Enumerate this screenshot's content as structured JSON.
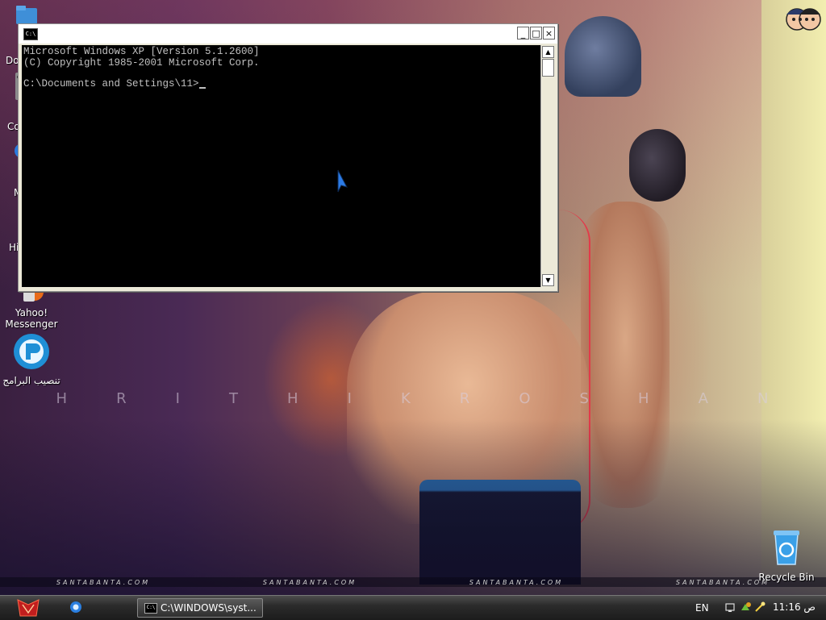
{
  "desktop": {
    "wallpaper_text": "H R I T H I K R O S H A N",
    "wallpaper_letters": [
      "H",
      "R",
      "I",
      "T",
      "H",
      "I",
      "K",
      "R",
      "O",
      "S",
      "H",
      "A",
      "N"
    ],
    "watermark": "SANTABANTA.COM",
    "watermarks": [
      "SANTABANTA.COM",
      "SANTABANTA.COM",
      "SANTABANTA.COM",
      "SANTABANTA.COM"
    ],
    "icons": {
      "docs_partial": "Do",
      "computer_partial": "Co",
      "net_partial": "M",
      "hi_partial": "Hi",
      "yahoo": "Yahoo! Messenger",
      "install": "تنصيب البرامج",
      "recycle": "Recycle Bin"
    }
  },
  "cmd_window": {
    "title_icon_text": "C:\\",
    "lines": [
      "Microsoft Windows XP [Version 5.1.2600]",
      "(C) Copyright 1985-2001 Microsoft Corp.",
      "",
      "C:\\Documents and Settings\\11>"
    ],
    "buttons": {
      "minimize": "_",
      "maximize": "□",
      "close": "×"
    }
  },
  "taskbar": {
    "task_label": "C:\\WINDOWS\\syst...",
    "task_icon_text": "C:\\",
    "language": "EN",
    "clock": "11:16 ص"
  },
  "colors": {
    "console_bg": "#000000",
    "console_fg": "#c0c0c0",
    "taskbar": "#2b2b2b"
  }
}
